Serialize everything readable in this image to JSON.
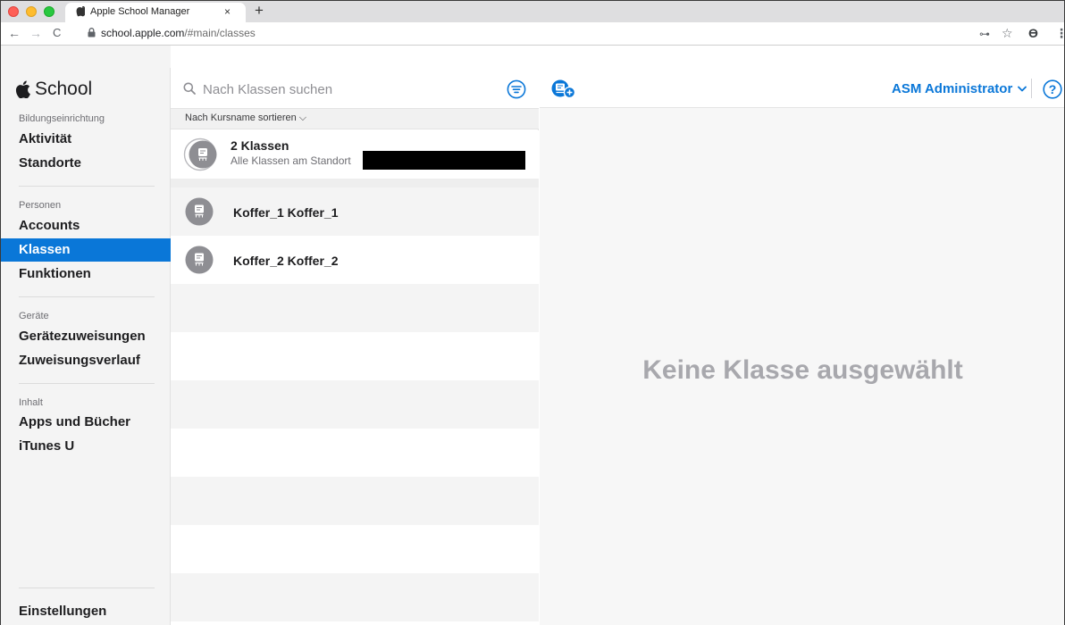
{
  "browser": {
    "tab_title": "Apple School Manager",
    "tab_close": "×",
    "new_tab": "+",
    "url_host": "school.apple.com",
    "url_path": "/#main/classes",
    "back": "←",
    "forward": "→",
    "reload": "C",
    "key_icon": "⊶",
    "star_icon": "☆",
    "profile_icon": "Ɵ",
    "menu_icon": "⋮"
  },
  "app": {
    "brand": "School",
    "sidebar": {
      "sections": [
        {
          "label": "Bildungseinrichtung",
          "items": [
            "Aktivität",
            "Standorte"
          ]
        },
        {
          "label": "Personen",
          "items": [
            "Accounts",
            "Klassen",
            "Funktionen"
          ]
        },
        {
          "label": "Geräte",
          "items": [
            "Gerätezuweisungen",
            "Zuweisungsverlauf"
          ]
        },
        {
          "label": "Inhalt",
          "items": [
            "Apps und Bücher",
            "iTunes U"
          ]
        }
      ],
      "active_item": "Klassen",
      "settings": "Einstellungen"
    },
    "list": {
      "search_placeholder": "Nach Klassen suchen",
      "sort_label": "Nach Kursname sortieren ⌵",
      "summary_title": "2 Klassen",
      "summary_subtitle": "Alle Klassen am Standort",
      "rows": [
        "Koffer_1 Koffer_1",
        "Koffer_2 Koffer_2"
      ]
    },
    "header": {
      "account": "ASM Administrator",
      "help": "?"
    },
    "detail": {
      "empty_state": "Keine Klasse ausgewählt"
    },
    "colors": {
      "accent": "#0a77d8",
      "active_nav": "#0a77d8"
    }
  }
}
